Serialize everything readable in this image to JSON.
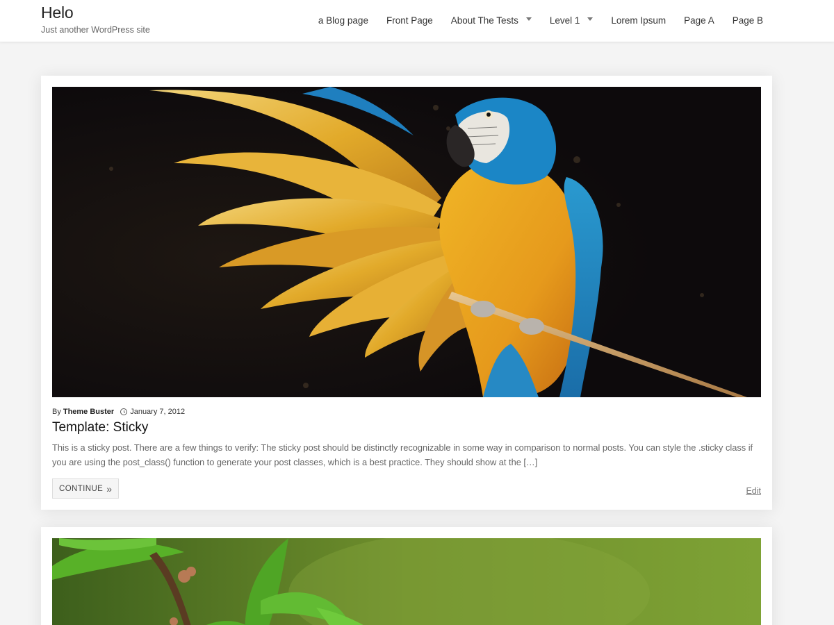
{
  "site": {
    "title": "Helo",
    "tagline": "Just another WordPress site"
  },
  "nav": {
    "items": [
      {
        "label": "a Blog page",
        "has_submenu": false
      },
      {
        "label": "Front Page",
        "has_submenu": false
      },
      {
        "label": "About The Tests",
        "has_submenu": true
      },
      {
        "label": "Level 1",
        "has_submenu": true
      },
      {
        "label": "Lorem Ipsum",
        "has_submenu": false
      },
      {
        "label": "Page A",
        "has_submenu": false
      },
      {
        "label": "Page B",
        "has_submenu": false
      }
    ]
  },
  "posts": [
    {
      "image_subject": "blue-and-gold macaw perched on a branch",
      "by_label": "By",
      "author": "Theme Buster",
      "date": "January 7, 2012",
      "title": "Template: Sticky",
      "excerpt": "This is a sticky post. There are a few things to verify: The sticky post should be distinctly recognizable in some way in comparison to normal posts. You can style the .sticky class if you are using the post_class() function to generate your post classes, which is a best practice. They should show at the […]",
      "continue_label": "CONTINUE",
      "continue_icon": "double-chevron-right-icon",
      "edit_label": "Edit"
    },
    {
      "image_subject": "green leaves on a branch"
    }
  ],
  "colors": {
    "page_background": "#f4f4f4",
    "card_background": "#ffffff",
    "title_text": "#111111",
    "body_text": "#666666"
  }
}
